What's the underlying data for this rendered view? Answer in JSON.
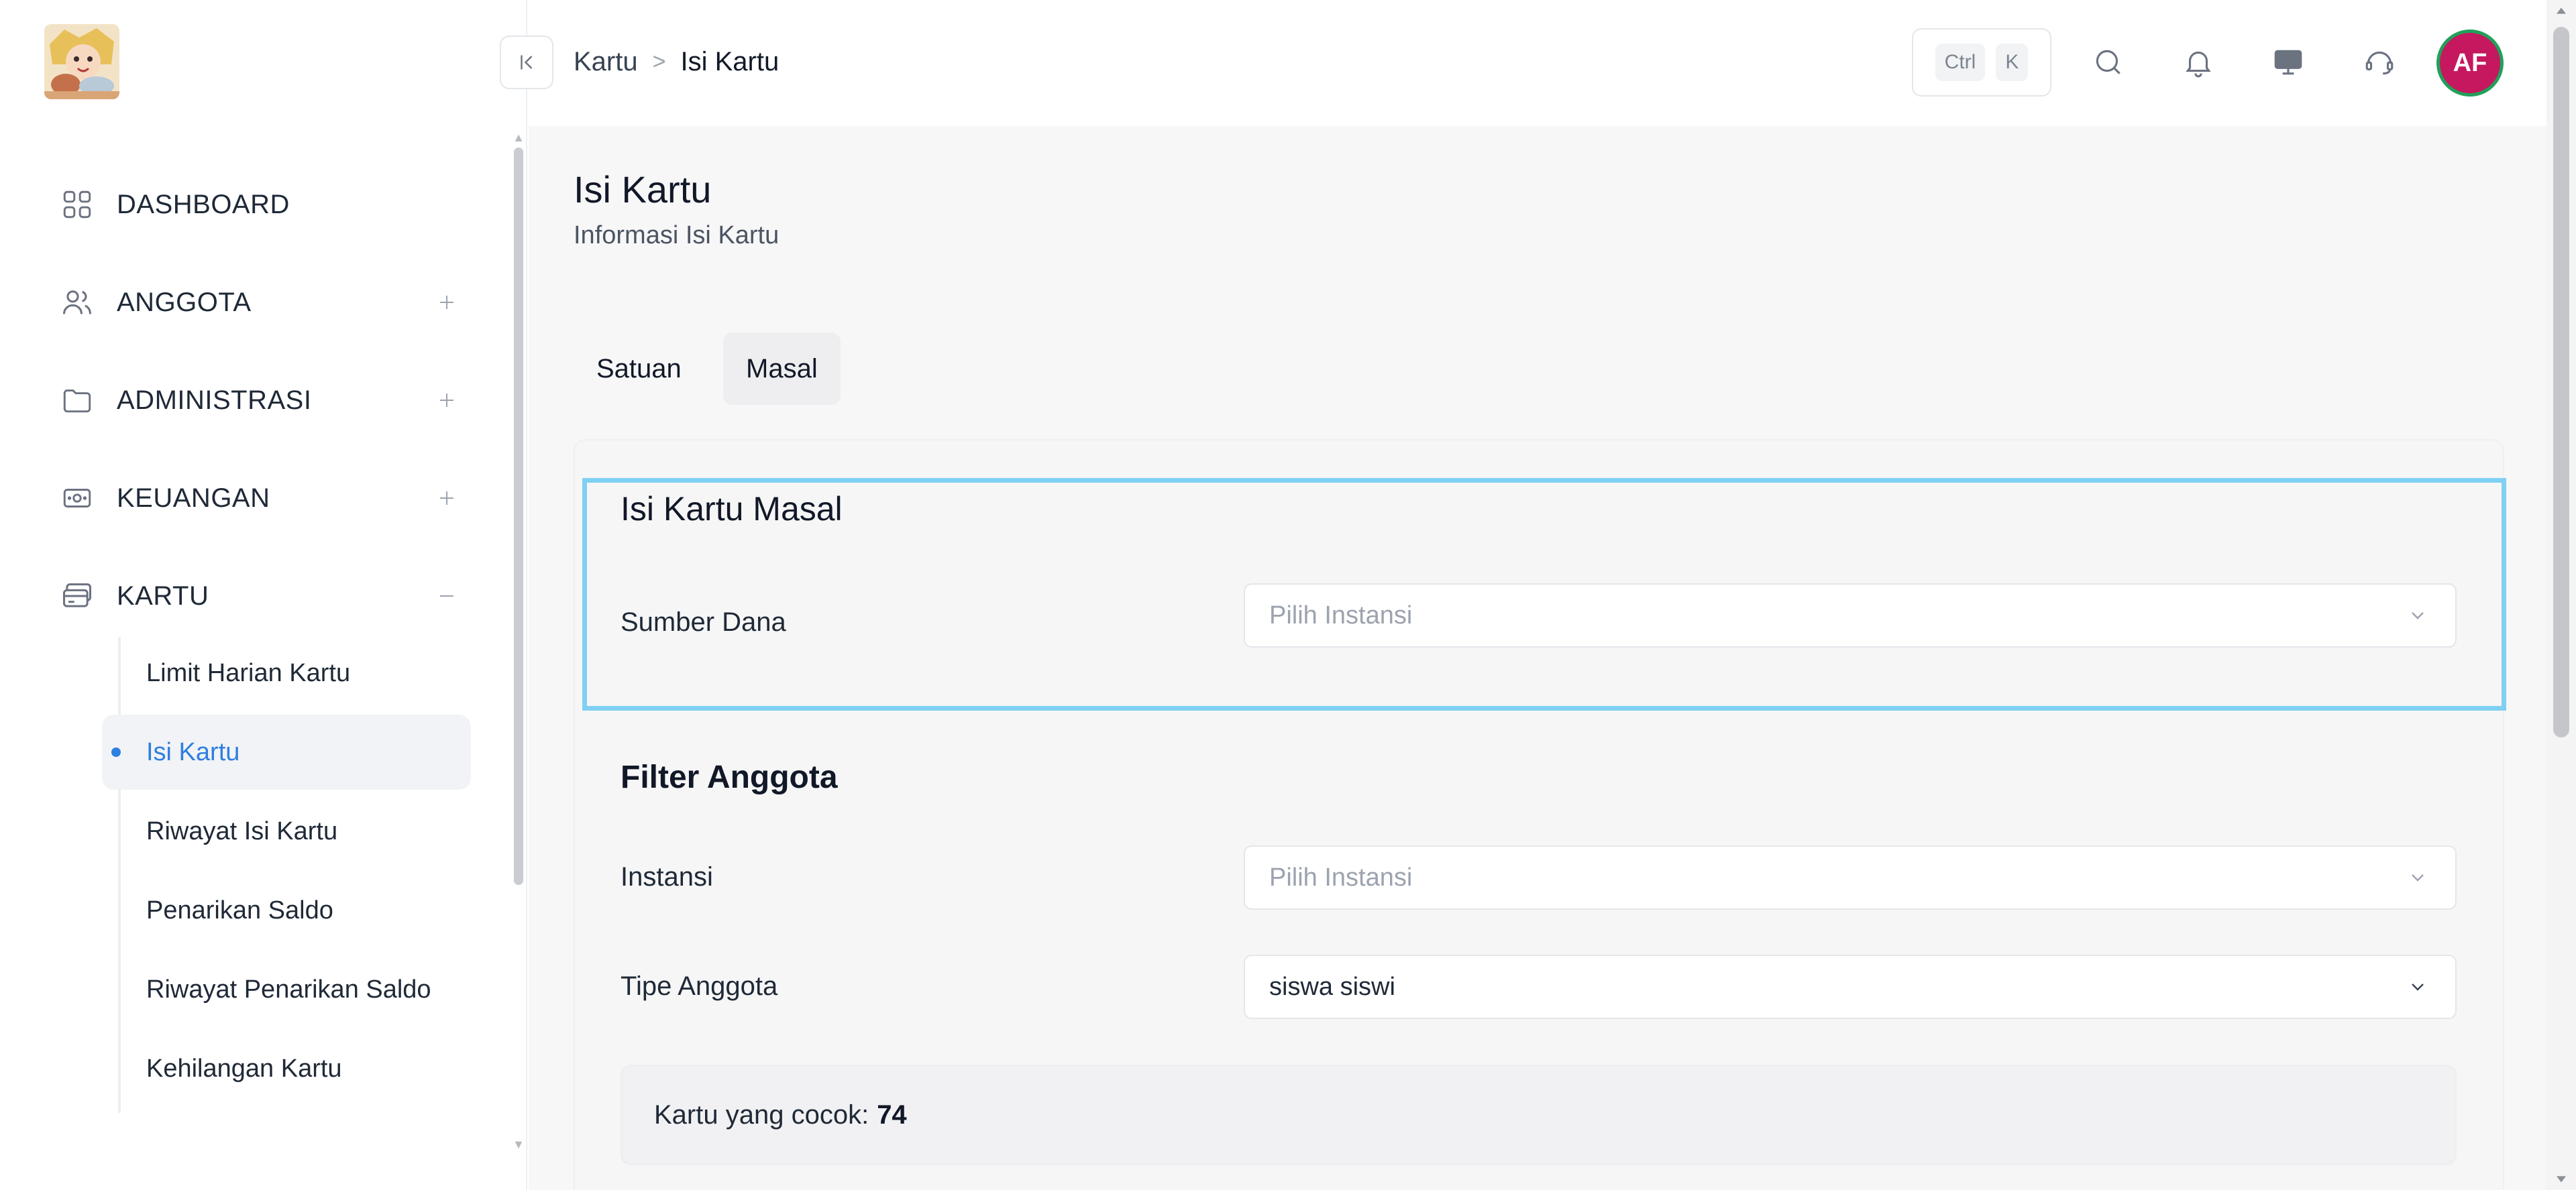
{
  "sidebar": {
    "items": [
      {
        "label": "DASHBOARD",
        "icon": "grid-icon",
        "expander": ""
      },
      {
        "label": "ANGGOTA",
        "icon": "users-icon",
        "expander": "plus"
      },
      {
        "label": "ADMINISTRASI",
        "icon": "folder-icon",
        "expander": "plus"
      },
      {
        "label": "KEUANGAN",
        "icon": "cash-icon",
        "expander": "plus"
      },
      {
        "label": "KARTU",
        "icon": "card-icon",
        "expander": "minus"
      }
    ],
    "kartu_sub": [
      {
        "label": "Limit Harian Kartu",
        "active": false
      },
      {
        "label": "Isi Kartu",
        "active": true
      },
      {
        "label": "Riwayat Isi Kartu",
        "active": false
      },
      {
        "label": "Penarikan Saldo",
        "active": false
      },
      {
        "label": "Riwayat Penarikan Saldo",
        "active": false
      },
      {
        "label": "Kehilangan Kartu",
        "active": false
      }
    ]
  },
  "header": {
    "breadcrumb": [
      "Kartu",
      "Isi Kartu"
    ],
    "shortcut_keys": [
      "Ctrl",
      "K"
    ],
    "icons": [
      "search-icon",
      "bell-icon",
      "monitor-icon",
      "headset-icon"
    ],
    "avatar_initials": "AF"
  },
  "page": {
    "title": "Isi Kartu",
    "subtitle": "Informasi Isi Kartu",
    "tabs": [
      {
        "label": "Satuan",
        "active": false
      },
      {
        "label": "Masal",
        "active": true
      }
    ]
  },
  "form": {
    "section_title": "Isi Kartu Masal",
    "sumber_dana": {
      "label": "Sumber Dana",
      "placeholder": "Pilih Instansi"
    },
    "filter_title": "Filter Anggota",
    "instansi": {
      "label": "Instansi",
      "placeholder": "Pilih Instansi"
    },
    "tipe_anggota": {
      "label": "Tipe Anggota",
      "value": "siswa siswi"
    },
    "match_label": "Kartu yang cocok:",
    "match_count": "74"
  },
  "colors": {
    "accent": "#2f7fe0",
    "highlight": "#7fd0f2",
    "avatar_bg": "#c5185f",
    "avatar_ring": "#22a05a"
  }
}
